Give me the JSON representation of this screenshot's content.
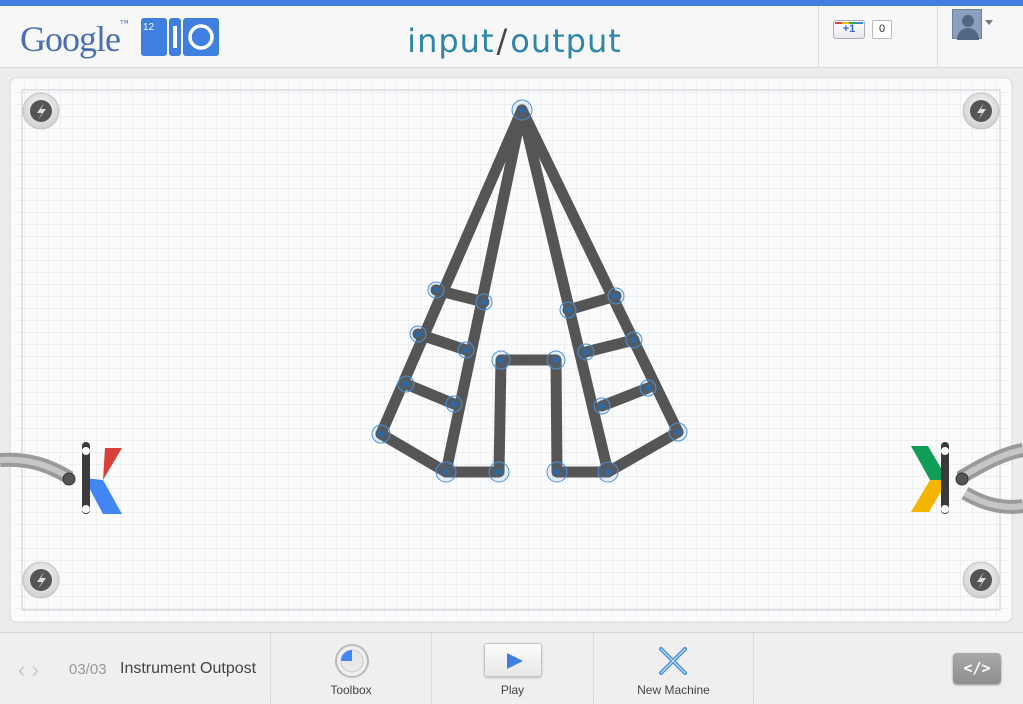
{
  "header": {
    "logo_text": "Google",
    "logo_tm": "™",
    "io_badge_number": "12",
    "title_left": "input",
    "title_slash": "/",
    "title_right": "output",
    "plus_one_label": "+1",
    "plus_one_count": "0"
  },
  "board": {
    "icons": [
      "bolt-screw-icon",
      "left-connector-icon",
      "right-connector-icon"
    ],
    "colors": {
      "tube": "#555555",
      "node": "#4a90d9",
      "left_red": "#d8413a",
      "left_blue": "#4285f4",
      "right_green": "#0f9d58",
      "right_yellow": "#f4b400"
    }
  },
  "footer": {
    "level_number": "03/03",
    "level_name": "Instrument Outpost",
    "toolbox_label": "Toolbox",
    "play_label": "Play",
    "new_machine_label": "New Machine",
    "code_label": "</>"
  }
}
